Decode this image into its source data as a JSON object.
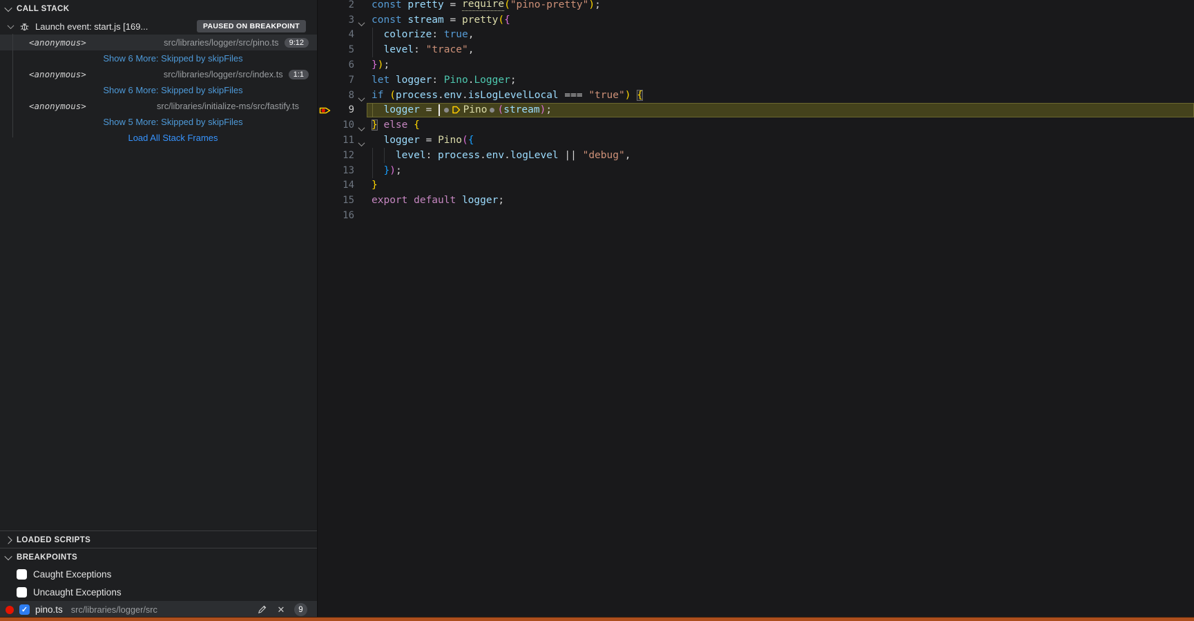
{
  "colors": {
    "sidebar_background": "#1e1f21",
    "editor_background": "#19191b",
    "row_selected": "#2c2e31",
    "link_blue": "#4e9ad9",
    "action_blue": "#3794ff",
    "badge_bg": "#4d4f54",
    "paused_badge_bg": "#47494e",
    "checkbox_checked_blue": "#2e7df0",
    "breakpoint_red": "#e51400",
    "execution_pointer_yellow": "#ffcc00",
    "current_line_bg": "#44421c",
    "current_line_border": "#6c682f",
    "status_bar_orange": "#ad4f1d"
  },
  "sidebar": {
    "call_stack": {
      "title": "CALL STACK",
      "session": {
        "label": "Launch event: start.js [169...",
        "badge": "PAUSED ON BREAKPOINT"
      },
      "rows": [
        {
          "type": "frame",
          "name": "<anonymous>",
          "path": "src/libraries/logger/src/pino.ts",
          "badge": "9:12",
          "selected": true
        },
        {
          "type": "link",
          "label": "Show 6 More: Skipped by skipFiles"
        },
        {
          "type": "frame",
          "name": "<anonymous>",
          "path": "src/libraries/logger/src/index.ts",
          "badge": "1:1"
        },
        {
          "type": "link",
          "label": "Show 6 More: Skipped by skipFiles"
        },
        {
          "type": "frame",
          "name": "<anonymous>",
          "path": "src/libraries/initialize-ms/src/fastify.ts"
        },
        {
          "type": "link",
          "label": "Show 5 More: Skipped by skipFiles"
        },
        {
          "type": "action",
          "label": "Load All Stack Frames"
        }
      ]
    },
    "loaded_scripts": {
      "title": "LOADED SCRIPTS"
    },
    "breakpoints": {
      "title": "BREAKPOINTS",
      "toggles": [
        {
          "label": "Caught Exceptions",
          "checked": false
        },
        {
          "label": "Uncaught Exceptions",
          "checked": false
        }
      ],
      "entries": [
        {
          "file": "pino.ts",
          "path": "src/libraries/logger/src",
          "line": "9",
          "checked": true,
          "selected": true
        }
      ]
    }
  },
  "editor": {
    "token_colors": {
      "kw": "#569CD6",
      "ctrl": "#C586C0",
      "var": "#9CDCFE",
      "fn": "#DCDCAA",
      "fnu": "#DCDCAA",
      "type": "#4EC9B0",
      "str": "#CE9178",
      "pun": "#D4D4D4",
      "b1": "#FFD700",
      "b1m": "#FFD700",
      "b2": "#DA70D6",
      "b3": "#179FFF"
    },
    "lines": [
      {
        "num": 2,
        "tokens": [
          [
            "kw",
            "const "
          ],
          [
            "var",
            "pretty"
          ],
          [
            "pun",
            " = "
          ],
          [
            "fnu",
            "require"
          ],
          [
            "b1",
            "("
          ],
          [
            "str",
            "\"pino-pretty\""
          ],
          [
            "b1",
            ")"
          ],
          [
            "pun",
            ";"
          ]
        ]
      },
      {
        "num": 3,
        "fold": true,
        "tokens": [
          [
            "kw",
            "const "
          ],
          [
            "var",
            "stream"
          ],
          [
            "pun",
            " = "
          ],
          [
            "fn",
            "pretty"
          ],
          [
            "b1",
            "("
          ],
          [
            "b2",
            "{"
          ]
        ]
      },
      {
        "num": 4,
        "guide": true,
        "tokens": [
          [
            "pun",
            "  "
          ],
          [
            "var",
            "colorize"
          ],
          [
            "pun",
            ": "
          ],
          [
            "kw",
            "true"
          ],
          [
            "pun",
            ","
          ]
        ]
      },
      {
        "num": 5,
        "guide": true,
        "tokens": [
          [
            "pun",
            "  "
          ],
          [
            "var",
            "level"
          ],
          [
            "pun",
            ": "
          ],
          [
            "str",
            "\"trace\""
          ],
          [
            "pun",
            ","
          ]
        ]
      },
      {
        "num": 6,
        "tokens": [
          [
            "b2",
            "}"
          ],
          [
            "b1",
            ")"
          ],
          [
            "pun",
            ";"
          ]
        ]
      },
      {
        "num": 7,
        "tokens": [
          [
            "kw",
            "let "
          ],
          [
            "var",
            "logger"
          ],
          [
            "pun",
            ": "
          ],
          [
            "type",
            "Pino"
          ],
          [
            "pun",
            "."
          ],
          [
            "type",
            "Logger"
          ],
          [
            "pun",
            ";"
          ]
        ]
      },
      {
        "num": 8,
        "fold": true,
        "tokens": [
          [
            "kw",
            "if "
          ],
          [
            "b1",
            "("
          ],
          [
            "var",
            "process"
          ],
          [
            "pun",
            "."
          ],
          [
            "var",
            "env"
          ],
          [
            "pun",
            "."
          ],
          [
            "var",
            "isLogLevelLocal"
          ],
          [
            "pun",
            " === "
          ],
          [
            "str",
            "\"true\""
          ],
          [
            "b1",
            ")"
          ],
          [
            "pun",
            " "
          ],
          [
            "b1m",
            "{"
          ]
        ]
      },
      {
        "num": 9,
        "current": true,
        "guide": true,
        "tokens": [
          [
            "pun",
            "  "
          ],
          [
            "var",
            "logger"
          ],
          [
            "pun",
            " = "
          ],
          [
            "cursor",
            ""
          ],
          [
            "dot",
            ""
          ],
          [
            "picon",
            ""
          ],
          [
            "fn",
            "Pino"
          ],
          [
            "dot",
            ""
          ],
          [
            "b2",
            "("
          ],
          [
            "var",
            "stream"
          ],
          [
            "b2",
            ")"
          ],
          [
            "pun",
            ";"
          ]
        ]
      },
      {
        "num": 10,
        "fold": true,
        "tokens": [
          [
            "b1m",
            "}"
          ],
          [
            "ctrl",
            " else "
          ],
          [
            "b1",
            "{"
          ]
        ]
      },
      {
        "num": 11,
        "fold": true,
        "tokens": [
          [
            "pun",
            "  "
          ],
          [
            "var",
            "logger"
          ],
          [
            "pun",
            " = "
          ],
          [
            "fn",
            "Pino"
          ],
          [
            "b2",
            "("
          ],
          [
            "b3",
            "{"
          ]
        ]
      },
      {
        "num": 12,
        "guide": true,
        "guide2": true,
        "tokens": [
          [
            "pun",
            "    "
          ],
          [
            "var",
            "level"
          ],
          [
            "pun",
            ": "
          ],
          [
            "var",
            "process"
          ],
          [
            "pun",
            "."
          ],
          [
            "var",
            "env"
          ],
          [
            "pun",
            "."
          ],
          [
            "var",
            "logLevel"
          ],
          [
            "pun",
            " || "
          ],
          [
            "str",
            "\"debug\""
          ],
          [
            "pun",
            ","
          ]
        ]
      },
      {
        "num": 13,
        "guide": true,
        "tokens": [
          [
            "pun",
            "  "
          ],
          [
            "b3",
            "}"
          ],
          [
            "b2",
            ")"
          ],
          [
            "pun",
            ";"
          ]
        ]
      },
      {
        "num": 14,
        "tokens": [
          [
            "b1",
            "}"
          ]
        ]
      },
      {
        "num": 15,
        "tokens": [
          [
            "ctrl",
            "export default "
          ],
          [
            "var",
            "logger"
          ],
          [
            "pun",
            ";"
          ]
        ]
      },
      {
        "num": 16,
        "tokens": []
      }
    ]
  }
}
